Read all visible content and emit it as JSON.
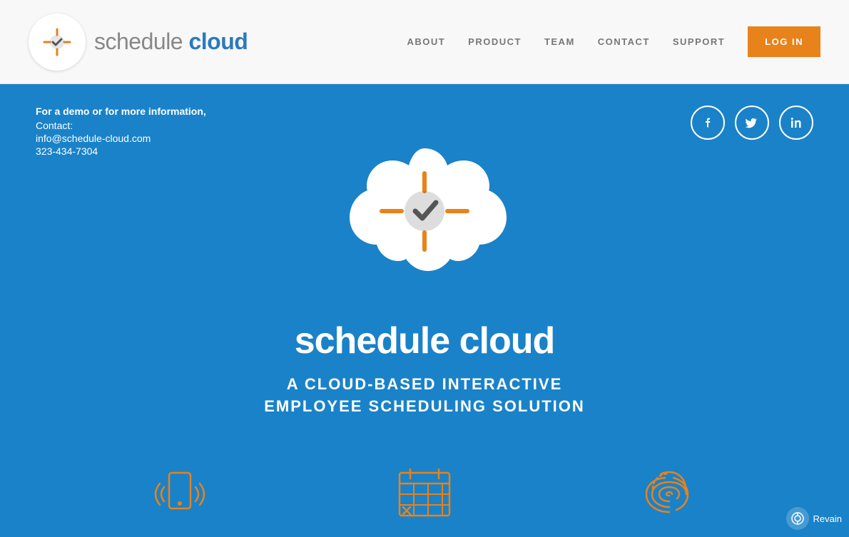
{
  "header": {
    "logo_text_regular": "schedule ",
    "logo_text_bold": "cloud",
    "nav_items": [
      {
        "label": "ABOUT",
        "id": "about"
      },
      {
        "label": "PRODUCT",
        "id": "product"
      },
      {
        "label": "TEAM",
        "id": "team"
      },
      {
        "label": "CONTACT",
        "id": "contact"
      },
      {
        "label": "SUPPORT",
        "id": "support"
      }
    ],
    "login_label": "LOG IN"
  },
  "hero": {
    "contact": {
      "demo_text": "For a demo or for more information,",
      "contact_label": "Contact:",
      "email": "info@schedule-cloud.com",
      "phone": "323-434-7304"
    },
    "social": [
      {
        "icon": "f",
        "name": "facebook"
      },
      {
        "icon": "t",
        "name": "twitter"
      },
      {
        "icon": "in",
        "name": "linkedin"
      }
    ],
    "brand_regular": "schedule ",
    "brand_bold": "cloud",
    "subtitle_line1": "A CLOUD-BASED INTERACTIVE",
    "subtitle_line2": "EMPLOYEE SCHEDULING SOLUTION"
  },
  "revain": {
    "label": "Revain"
  },
  "colors": {
    "hero_bg": "#1a82c8",
    "orange": "#e8821a",
    "nav_text": "#777777",
    "white": "#ffffff"
  }
}
